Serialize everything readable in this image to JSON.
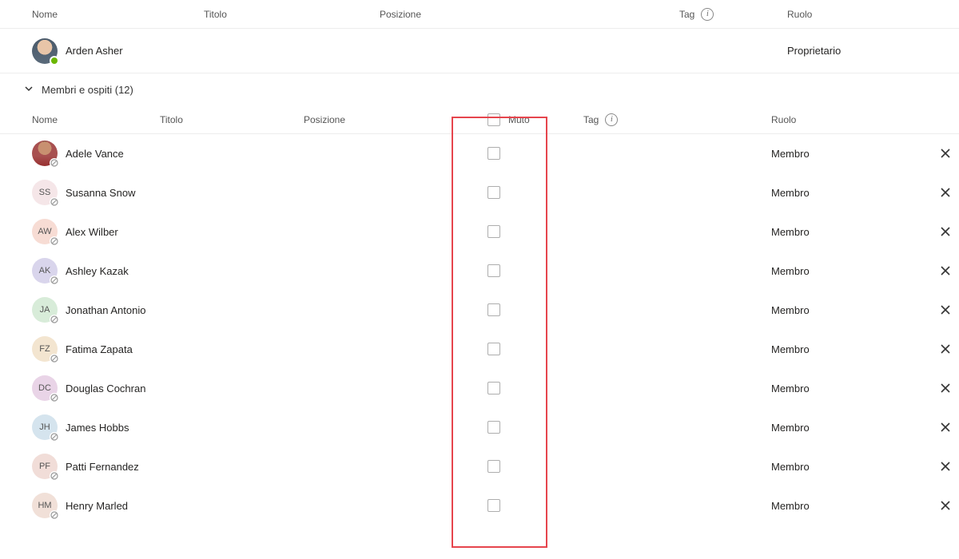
{
  "headers1": {
    "nome": "Nome",
    "titolo": "Titolo",
    "posizione": "Posizione",
    "tag": "Tag",
    "ruolo": "Ruolo"
  },
  "owner": {
    "name": "Arden Asher",
    "role": "Proprietario"
  },
  "group": {
    "label": "Membri e ospiti (12)"
  },
  "headers2": {
    "nome": "Nome",
    "titolo": "Titolo",
    "posizione": "Posizione",
    "muto": "Muto",
    "tag": "Tag",
    "ruolo": "Ruolo"
  },
  "members": [
    {
      "name": "Adele Vance",
      "initials": "",
      "bg": "photo",
      "role": "Membro"
    },
    {
      "name": "Susanna Snow",
      "initials": "SS",
      "bg": "#f5e6e8",
      "role": "Membro"
    },
    {
      "name": "Alex Wilber",
      "initials": "AW",
      "bg": "#f7dcd4",
      "role": "Membro"
    },
    {
      "name": "Ashley Kazak",
      "initials": "AK",
      "bg": "#d9d5ec",
      "role": "Membro"
    },
    {
      "name": "Jonathan Antonio",
      "initials": "JA",
      "bg": "#d8ecd9",
      "role": "Membro"
    },
    {
      "name": "Fatima Zapata",
      "initials": "FZ",
      "bg": "#f3e5d0",
      "role": "Membro"
    },
    {
      "name": "Douglas Cochran",
      "initials": "DC",
      "bg": "#e9d4e7",
      "role": "Membro"
    },
    {
      "name": "James Hobbs",
      "initials": "JH",
      "bg": "#d5e4ee",
      "role": "Membro"
    },
    {
      "name": "Patti Fernandez",
      "initials": "PF",
      "bg": "#f1ddd8",
      "role": "Membro"
    },
    {
      "name": "Henry Marled",
      "initials": "HM",
      "bg": "#f1e0d8",
      "role": "Membro"
    }
  ]
}
